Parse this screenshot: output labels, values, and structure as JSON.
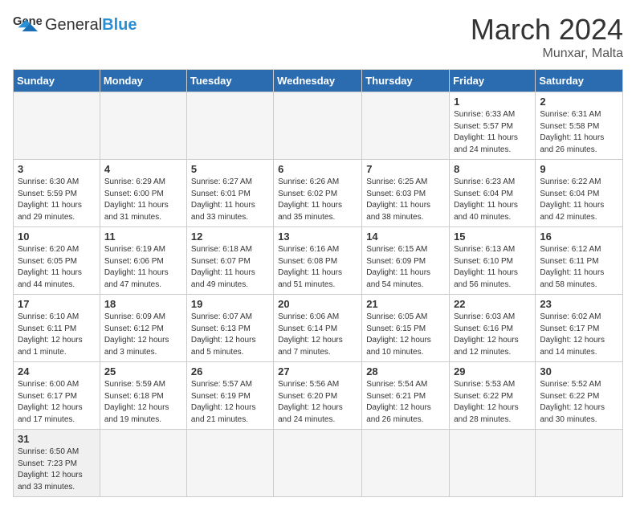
{
  "header": {
    "logo_general": "General",
    "logo_blue": "Blue",
    "month_year": "March 2024",
    "location": "Munxar, Malta"
  },
  "days_of_week": [
    "Sunday",
    "Monday",
    "Tuesday",
    "Wednesday",
    "Thursday",
    "Friday",
    "Saturday"
  ],
  "weeks": [
    [
      {
        "day": "",
        "info": ""
      },
      {
        "day": "",
        "info": ""
      },
      {
        "day": "",
        "info": ""
      },
      {
        "day": "",
        "info": ""
      },
      {
        "day": "",
        "info": ""
      },
      {
        "day": "1",
        "info": "Sunrise: 6:33 AM\nSunset: 5:57 PM\nDaylight: 11 hours\nand 24 minutes."
      },
      {
        "day": "2",
        "info": "Sunrise: 6:31 AM\nSunset: 5:58 PM\nDaylight: 11 hours\nand 26 minutes."
      }
    ],
    [
      {
        "day": "3",
        "info": "Sunrise: 6:30 AM\nSunset: 5:59 PM\nDaylight: 11 hours\nand 29 minutes."
      },
      {
        "day": "4",
        "info": "Sunrise: 6:29 AM\nSunset: 6:00 PM\nDaylight: 11 hours\nand 31 minutes."
      },
      {
        "day": "5",
        "info": "Sunrise: 6:27 AM\nSunset: 6:01 PM\nDaylight: 11 hours\nand 33 minutes."
      },
      {
        "day": "6",
        "info": "Sunrise: 6:26 AM\nSunset: 6:02 PM\nDaylight: 11 hours\nand 35 minutes."
      },
      {
        "day": "7",
        "info": "Sunrise: 6:25 AM\nSunset: 6:03 PM\nDaylight: 11 hours\nand 38 minutes."
      },
      {
        "day": "8",
        "info": "Sunrise: 6:23 AM\nSunset: 6:04 PM\nDaylight: 11 hours\nand 40 minutes."
      },
      {
        "day": "9",
        "info": "Sunrise: 6:22 AM\nSunset: 6:04 PM\nDaylight: 11 hours\nand 42 minutes."
      }
    ],
    [
      {
        "day": "10",
        "info": "Sunrise: 6:20 AM\nSunset: 6:05 PM\nDaylight: 11 hours\nand 44 minutes."
      },
      {
        "day": "11",
        "info": "Sunrise: 6:19 AM\nSunset: 6:06 PM\nDaylight: 11 hours\nand 47 minutes."
      },
      {
        "day": "12",
        "info": "Sunrise: 6:18 AM\nSunset: 6:07 PM\nDaylight: 11 hours\nand 49 minutes."
      },
      {
        "day": "13",
        "info": "Sunrise: 6:16 AM\nSunset: 6:08 PM\nDaylight: 11 hours\nand 51 minutes."
      },
      {
        "day": "14",
        "info": "Sunrise: 6:15 AM\nSunset: 6:09 PM\nDaylight: 11 hours\nand 54 minutes."
      },
      {
        "day": "15",
        "info": "Sunrise: 6:13 AM\nSunset: 6:10 PM\nDaylight: 11 hours\nand 56 minutes."
      },
      {
        "day": "16",
        "info": "Sunrise: 6:12 AM\nSunset: 6:11 PM\nDaylight: 11 hours\nand 58 minutes."
      }
    ],
    [
      {
        "day": "17",
        "info": "Sunrise: 6:10 AM\nSunset: 6:11 PM\nDaylight: 12 hours\nand 1 minute."
      },
      {
        "day": "18",
        "info": "Sunrise: 6:09 AM\nSunset: 6:12 PM\nDaylight: 12 hours\nand 3 minutes."
      },
      {
        "day": "19",
        "info": "Sunrise: 6:07 AM\nSunset: 6:13 PM\nDaylight: 12 hours\nand 5 minutes."
      },
      {
        "day": "20",
        "info": "Sunrise: 6:06 AM\nSunset: 6:14 PM\nDaylight: 12 hours\nand 7 minutes."
      },
      {
        "day": "21",
        "info": "Sunrise: 6:05 AM\nSunset: 6:15 PM\nDaylight: 12 hours\nand 10 minutes."
      },
      {
        "day": "22",
        "info": "Sunrise: 6:03 AM\nSunset: 6:16 PM\nDaylight: 12 hours\nand 12 minutes."
      },
      {
        "day": "23",
        "info": "Sunrise: 6:02 AM\nSunset: 6:17 PM\nDaylight: 12 hours\nand 14 minutes."
      }
    ],
    [
      {
        "day": "24",
        "info": "Sunrise: 6:00 AM\nSunset: 6:17 PM\nDaylight: 12 hours\nand 17 minutes."
      },
      {
        "day": "25",
        "info": "Sunrise: 5:59 AM\nSunset: 6:18 PM\nDaylight: 12 hours\nand 19 minutes."
      },
      {
        "day": "26",
        "info": "Sunrise: 5:57 AM\nSunset: 6:19 PM\nDaylight: 12 hours\nand 21 minutes."
      },
      {
        "day": "27",
        "info": "Sunrise: 5:56 AM\nSunset: 6:20 PM\nDaylight: 12 hours\nand 24 minutes."
      },
      {
        "day": "28",
        "info": "Sunrise: 5:54 AM\nSunset: 6:21 PM\nDaylight: 12 hours\nand 26 minutes."
      },
      {
        "day": "29",
        "info": "Sunrise: 5:53 AM\nSunset: 6:22 PM\nDaylight: 12 hours\nand 28 minutes."
      },
      {
        "day": "30",
        "info": "Sunrise: 5:52 AM\nSunset: 6:22 PM\nDaylight: 12 hours\nand 30 minutes."
      }
    ],
    [
      {
        "day": "31",
        "info": "Sunrise: 6:50 AM\nSunset: 7:23 PM\nDaylight: 12 hours\nand 33 minutes."
      },
      {
        "day": "",
        "info": ""
      },
      {
        "day": "",
        "info": ""
      },
      {
        "day": "",
        "info": ""
      },
      {
        "day": "",
        "info": ""
      },
      {
        "day": "",
        "info": ""
      },
      {
        "day": "",
        "info": ""
      }
    ]
  ]
}
